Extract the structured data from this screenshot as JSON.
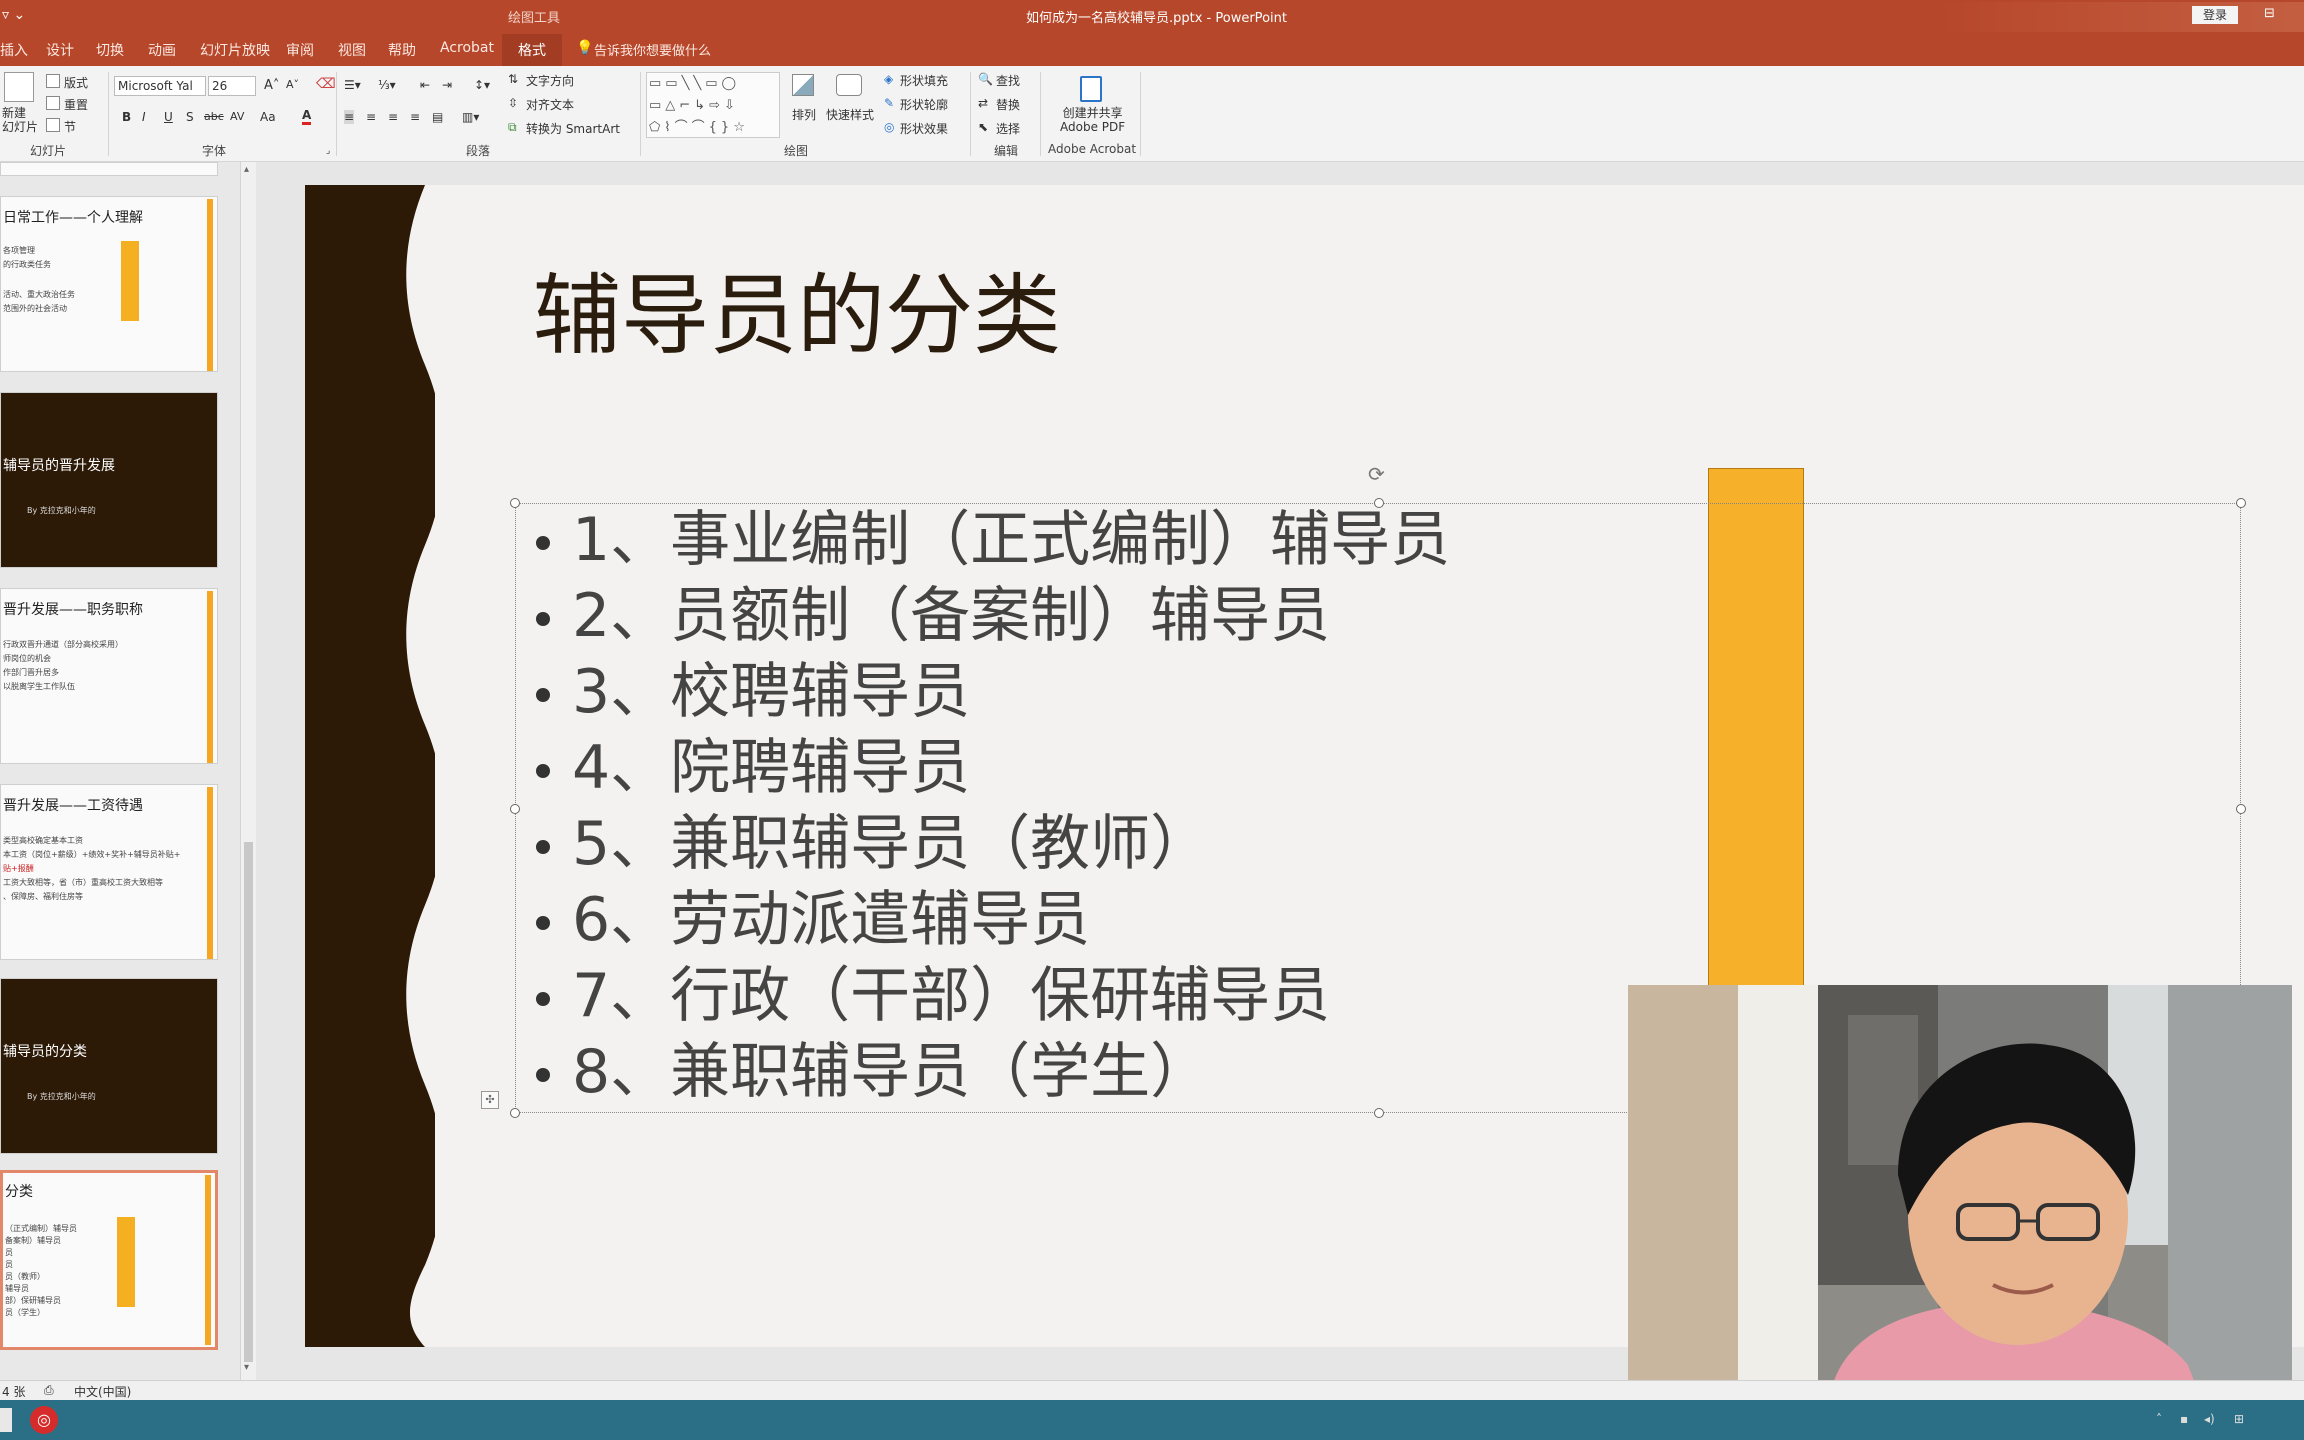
{
  "window": {
    "title": "如何成为一名高校辅导员.pptx  -  PowerPoint",
    "contextual_tab_group": "绘图工具",
    "login_button": "登录",
    "tell_me": "告诉我你想要做什么"
  },
  "ribbon_tabs": [
    {
      "label": "插入"
    },
    {
      "label": "设计"
    },
    {
      "label": "切换"
    },
    {
      "label": "动画"
    },
    {
      "label": "幻灯片放映"
    },
    {
      "label": "审阅"
    },
    {
      "label": "视图"
    },
    {
      "label": "帮助"
    },
    {
      "label": "Acrobat"
    },
    {
      "label": "格式"
    }
  ],
  "ribbon": {
    "slides": {
      "new_slide": "新建\n幻灯片",
      "layout": "版式",
      "reset": "重置",
      "section": "节",
      "label": "幻灯片"
    },
    "font": {
      "name": "Microsoft Yal",
      "size": "26",
      "label": "字体",
      "bold": "B",
      "italic": "I",
      "underline": "U",
      "shadow": "S",
      "strike": "abc",
      "spacing": "AV",
      "case": "Aa"
    },
    "paragraph": {
      "text_direction": "文字方向",
      "align_text": "对齐文本",
      "smartart": "转换为 SmartArt",
      "label": "段落"
    },
    "drawing": {
      "arrange": "排列",
      "quick_styles": "快速样式",
      "shape_fill": "形状填充",
      "shape_outline": "形状轮廓",
      "shape_effects": "形状效果",
      "label": "绘图"
    },
    "editing": {
      "find": "查找",
      "replace": "替换",
      "select": "选择",
      "label": "编辑"
    },
    "acrobat": {
      "create_share": "创建并共享\nAdobe PDF",
      "label": "Adobe Acrobat"
    }
  },
  "thumbnails": [
    {
      "title": "日常工作——个人理解",
      "lines": [
        "各项管理",
        "的行政类任务",
        "",
        "活动、重大政治任务",
        "范围外的社会活动"
      ],
      "dark": false,
      "arrow": true
    },
    {
      "title": "辅导员的晋升发展",
      "lines": [
        "By 克拉克和小年的"
      ],
      "dark": true,
      "arrow": false
    },
    {
      "title": "晋升发展——职务职称",
      "lines": [
        "行政双晋升通道（部分高校采用）",
        "师岗位的机会",
        "作部门晋升居多",
        "以脱离学生工作队伍"
      ],
      "dark": false,
      "arrow": false
    },
    {
      "title": "晋升发展——工资待遇",
      "lines": [
        "类型高校确定基本工资",
        "本工资（岗位+薪级）+绩效+奖补+辅导员补贴+",
        "贴+报酬",
        "工资大致相等，省（市）重高校工资大致相等",
        "、保障房、福利住房等"
      ],
      "dark": false,
      "arrow": false
    },
    {
      "title": "辅导员的分类",
      "lines": [
        "By 克拉克和小年的"
      ],
      "dark": true,
      "arrow": false
    },
    {
      "title": "分类",
      "lines": [
        "（正式编制）辅导员",
        "备案制）辅导员",
        "员",
        "员",
        "员（教师）",
        "辅导员",
        "部）保研辅导员",
        "员（学生）"
      ],
      "dark": false,
      "arrow": true
    }
  ],
  "slide": {
    "title": "辅导员的分类",
    "bullets": [
      "1、事业编制（正式编制）辅导员",
      "2、员额制（备案制）辅导员",
      "3、校聘辅导员",
      "4、院聘辅导员",
      "5、兼职辅导员（教师）",
      "6、劳动派遣辅导员",
      "7、行政（干部）保研辅导员",
      "8、兼职辅导员（学生）"
    ]
  },
  "statusbar": {
    "slide_count": "4 张",
    "language": "中文(中国)"
  },
  "colors": {
    "accent": "#b7472a",
    "slide_dark": "#2c1a07",
    "orange": "#f7b02a"
  }
}
